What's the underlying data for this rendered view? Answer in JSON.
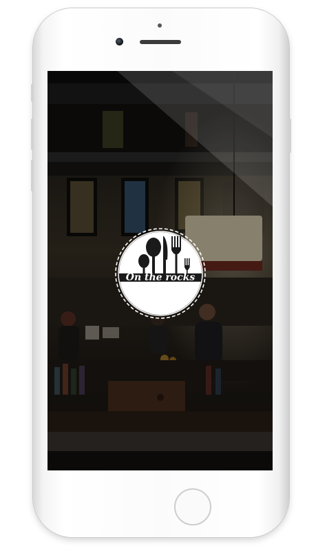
{
  "device": {
    "model": "iphone-white"
  },
  "splash": {
    "brand_name": "On the rocks",
    "logo_icons": [
      "spoon-icon",
      "spoon-icon",
      "knife-icon",
      "fork-icon",
      "fork-icon"
    ],
    "background": "restaurant-bar-photo"
  },
  "colors": {
    "frame": "#f7f7f7",
    "screen_overlay": "#000000",
    "logo_white": "#ffffff",
    "logo_dark": "#1a1a1a",
    "lamp_shade": "#f0e6c8",
    "lamp_band": "#8a2a20"
  }
}
